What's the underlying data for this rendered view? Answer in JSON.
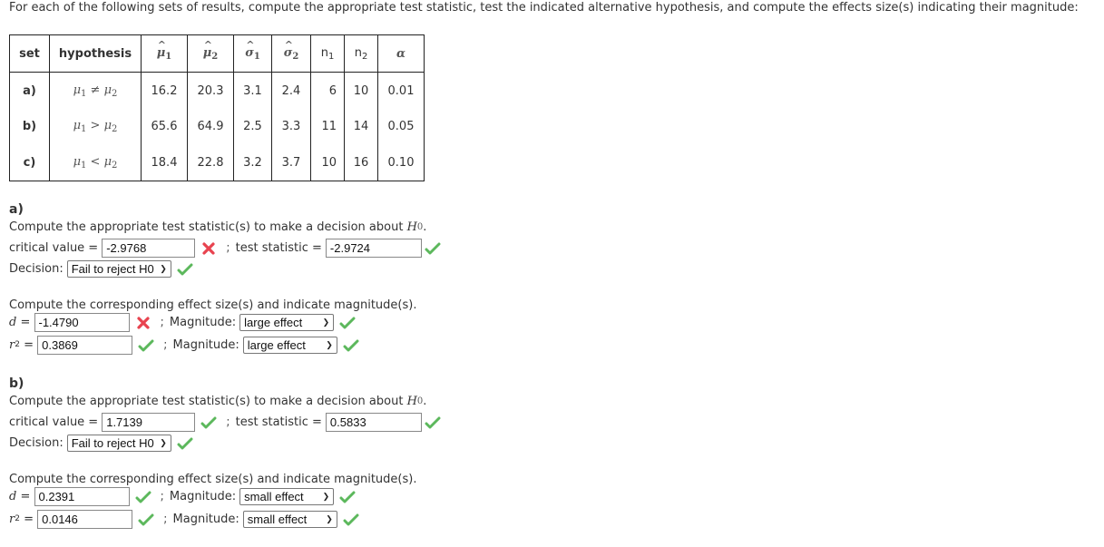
{
  "intro": "For each of the following sets of results, compute the appropriate test statistic, test the indicated alternative hypothesis, and compute the effects size(s) indicating their magnitude:",
  "table": {
    "headers": {
      "set": "set",
      "hypothesis": "hypothesis",
      "mu1": "μ",
      "mu1_sub": "1",
      "mu2": "μ",
      "mu2_sub": "2",
      "sigma1": "σ",
      "sigma1_sub": "1",
      "sigma2": "σ",
      "sigma2_sub": "2",
      "n1": "n",
      "n1_sub": "1",
      "n2": "n",
      "n2_sub": "2",
      "alpha": "α"
    },
    "rows": [
      {
        "set": "a)",
        "hyp_left": "μ",
        "hyp_left_sub": "1",
        "hyp_op": " ≠ ",
        "hyp_right": "μ",
        "hyp_right_sub": "2",
        "mu1": "16.2",
        "mu2": "20.3",
        "sigma1": "3.1",
        "sigma2": "2.4",
        "n1": "6",
        "n2": "10",
        "alpha": "0.01"
      },
      {
        "set": "b)",
        "hyp_left": "μ",
        "hyp_left_sub": "1",
        "hyp_op": " > ",
        "hyp_right": "μ",
        "hyp_right_sub": "2",
        "mu1": "65.6",
        "mu2": "64.9",
        "sigma1": "2.5",
        "sigma2": "3.3",
        "n1": "11",
        "n2": "14",
        "alpha": "0.05"
      },
      {
        "set": "c)",
        "hyp_left": "μ",
        "hyp_left_sub": "1",
        "hyp_op": " < ",
        "hyp_right": "μ",
        "hyp_right_sub": "2",
        "mu1": "18.4",
        "mu2": "22.8",
        "sigma1": "3.2",
        "sigma2": "3.7",
        "n1": "10",
        "n2": "16",
        "alpha": "0.10"
      }
    ]
  },
  "parts": [
    {
      "label": "a)",
      "prompt": "Compute the appropriate test statistic(s) to make a decision about ",
      "h0": "H",
      "h0_sub": "0",
      "prompt_end": ".",
      "critical_label": "critical value = ",
      "critical_value": "-2.9768",
      "critical_status": "incorrect",
      "semicolon": ";",
      "test_label": "test statistic = ",
      "test_value": "-2.9724",
      "test_status": "correct",
      "decision_label": "Decision:",
      "decision_value": "Fail to reject H0",
      "decision_status": "correct",
      "effect_prompt": "Compute the corresponding effect size(s) and indicate magnitude(s).",
      "d_label": "d",
      "eq": " = ",
      "d_value": "-1.4790",
      "d_status": "incorrect",
      "magnitude_label": "Magnitude:",
      "d_magnitude": "large effect",
      "d_magnitude_status": "correct",
      "r2_label": "r",
      "r2_sup": "2",
      "r2_value": "0.3869",
      "r2_status": "correct",
      "r2_magnitude": "large effect",
      "r2_magnitude_status": "correct"
    },
    {
      "label": "b)",
      "prompt": "Compute the appropriate test statistic(s) to make a decision about ",
      "h0": "H",
      "h0_sub": "0",
      "prompt_end": ".",
      "critical_label": "critical value = ",
      "critical_value": "1.7139",
      "critical_status": "correct",
      "semicolon": ";",
      "test_label": "test statistic = ",
      "test_value": "0.5833",
      "test_status": "correct",
      "decision_label": "Decision:",
      "decision_value": "Fail to reject H0",
      "decision_status": "correct",
      "effect_prompt": "Compute the corresponding effect size(s) and indicate magnitude(s).",
      "d_label": "d",
      "eq": " = ",
      "d_value": "0.2391",
      "d_status": "correct",
      "magnitude_label": "Magnitude:",
      "d_magnitude": "small effect",
      "d_magnitude_status": "correct",
      "r2_label": "r",
      "r2_sup": "2",
      "r2_value": "0.0146",
      "r2_status": "correct",
      "r2_magnitude": "small effect",
      "r2_magnitude_status": "correct"
    }
  ],
  "colors": {
    "correct": "#5cb85c",
    "incorrect": "#e8434f"
  }
}
